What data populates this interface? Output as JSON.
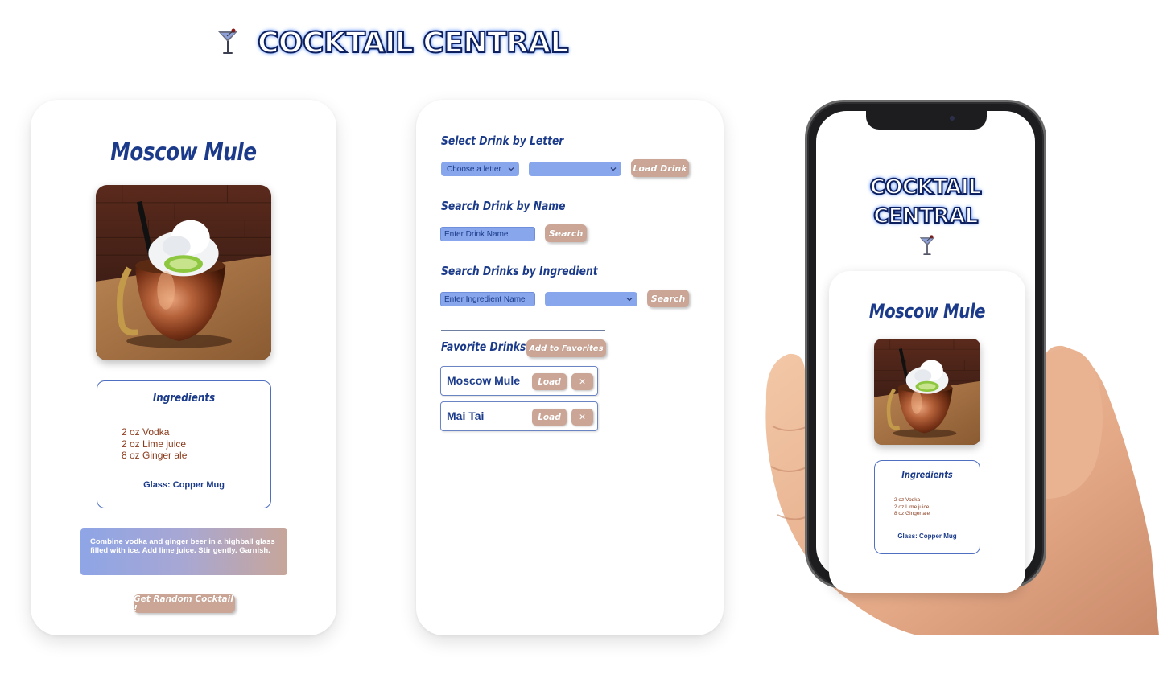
{
  "header": {
    "title": "COCKTAIL CENTRAL",
    "icon": "martini-glass-icon"
  },
  "drink_card": {
    "name": "Moscow Mule",
    "ingredients_title": "Ingredients",
    "ingredients": [
      "2 oz Vodka",
      "2 oz Lime juice",
      "8 oz Ginger ale"
    ],
    "glass": "Glass: Copper Mug",
    "instructions": "Combine vodka and ginger beer in a highball glass filled with ice. Add lime juice. Stir gently. Garnish.",
    "random_button": "Get Random Cocktail !"
  },
  "search_panel": {
    "letter_title": "Select Drink by Letter",
    "letter_select": "Choose a letter",
    "drink_select": "",
    "load_drink_button": "Load Drink",
    "name_title": "Search Drink by Name",
    "name_placeholder": "Enter Drink Name",
    "search_button": "Search",
    "ingredient_title": "Search Drinks by Ingredient",
    "ingredient_placeholder": "Enter Ingredient Name",
    "ingredient_select": "",
    "ingredient_search_button": "Search",
    "favorites_title": "Favorite Drinks",
    "add_favorites_button": "Add to Favorites",
    "favorites": [
      {
        "name": "Moscow Mule",
        "load": "Load",
        "remove": "✕"
      },
      {
        "name": "Mai Tai",
        "load": "Load",
        "remove": "✕"
      }
    ]
  },
  "phone": {
    "title_line1": "COCKTAIL",
    "title_line2": "CENTRAL",
    "drink_name": "Moscow Mule",
    "ingredients_title": "Ingredients",
    "ingredients": [
      "2 oz Vodka",
      "2 oz Lime juice",
      "8 oz Ginger ale"
    ],
    "glass": "Glass: Copper Mug"
  },
  "colors": {
    "navy": "#1b3b8a",
    "input_blue": "#88a6ec",
    "button_tan": "#cba696",
    "ingredient_brown": "#8a3b1c"
  }
}
